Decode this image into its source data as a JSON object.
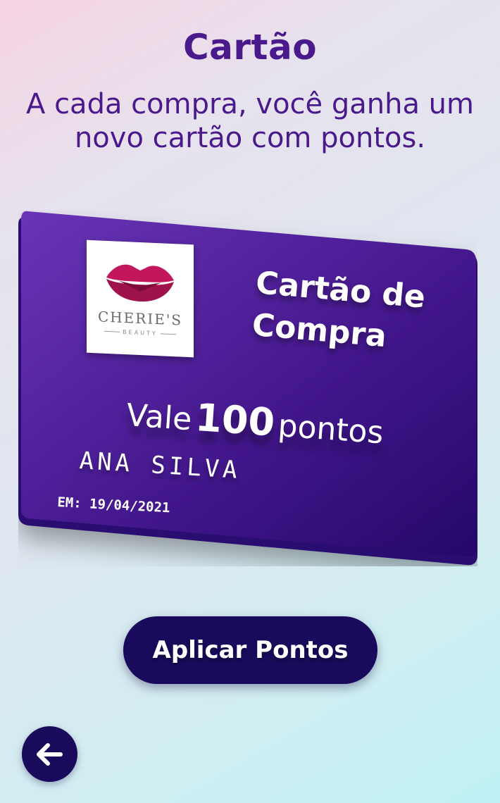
{
  "header": {
    "title": "Cartão",
    "subtitle": "A cada compra, você ganha um novo cartão com pontos."
  },
  "card": {
    "brand_name": "CHERIE'S",
    "brand_tagline": "BEAUTY",
    "title": "Cartão de Compra",
    "value_prefix": "Vale",
    "points": "100",
    "points_unit": "pontos",
    "holder_name": "ANA SILVA",
    "issue_date": "EM: 19/04/2021"
  },
  "actions": {
    "apply_label": "Aplicar Pontos",
    "back_icon": "arrow-left-icon"
  },
  "colors": {
    "primary": "#4a1a8c",
    "card_top": "#6a35b8",
    "card_bottom": "#24086a",
    "button": "#1a0a5c",
    "logo_lips": "#c2185b"
  }
}
